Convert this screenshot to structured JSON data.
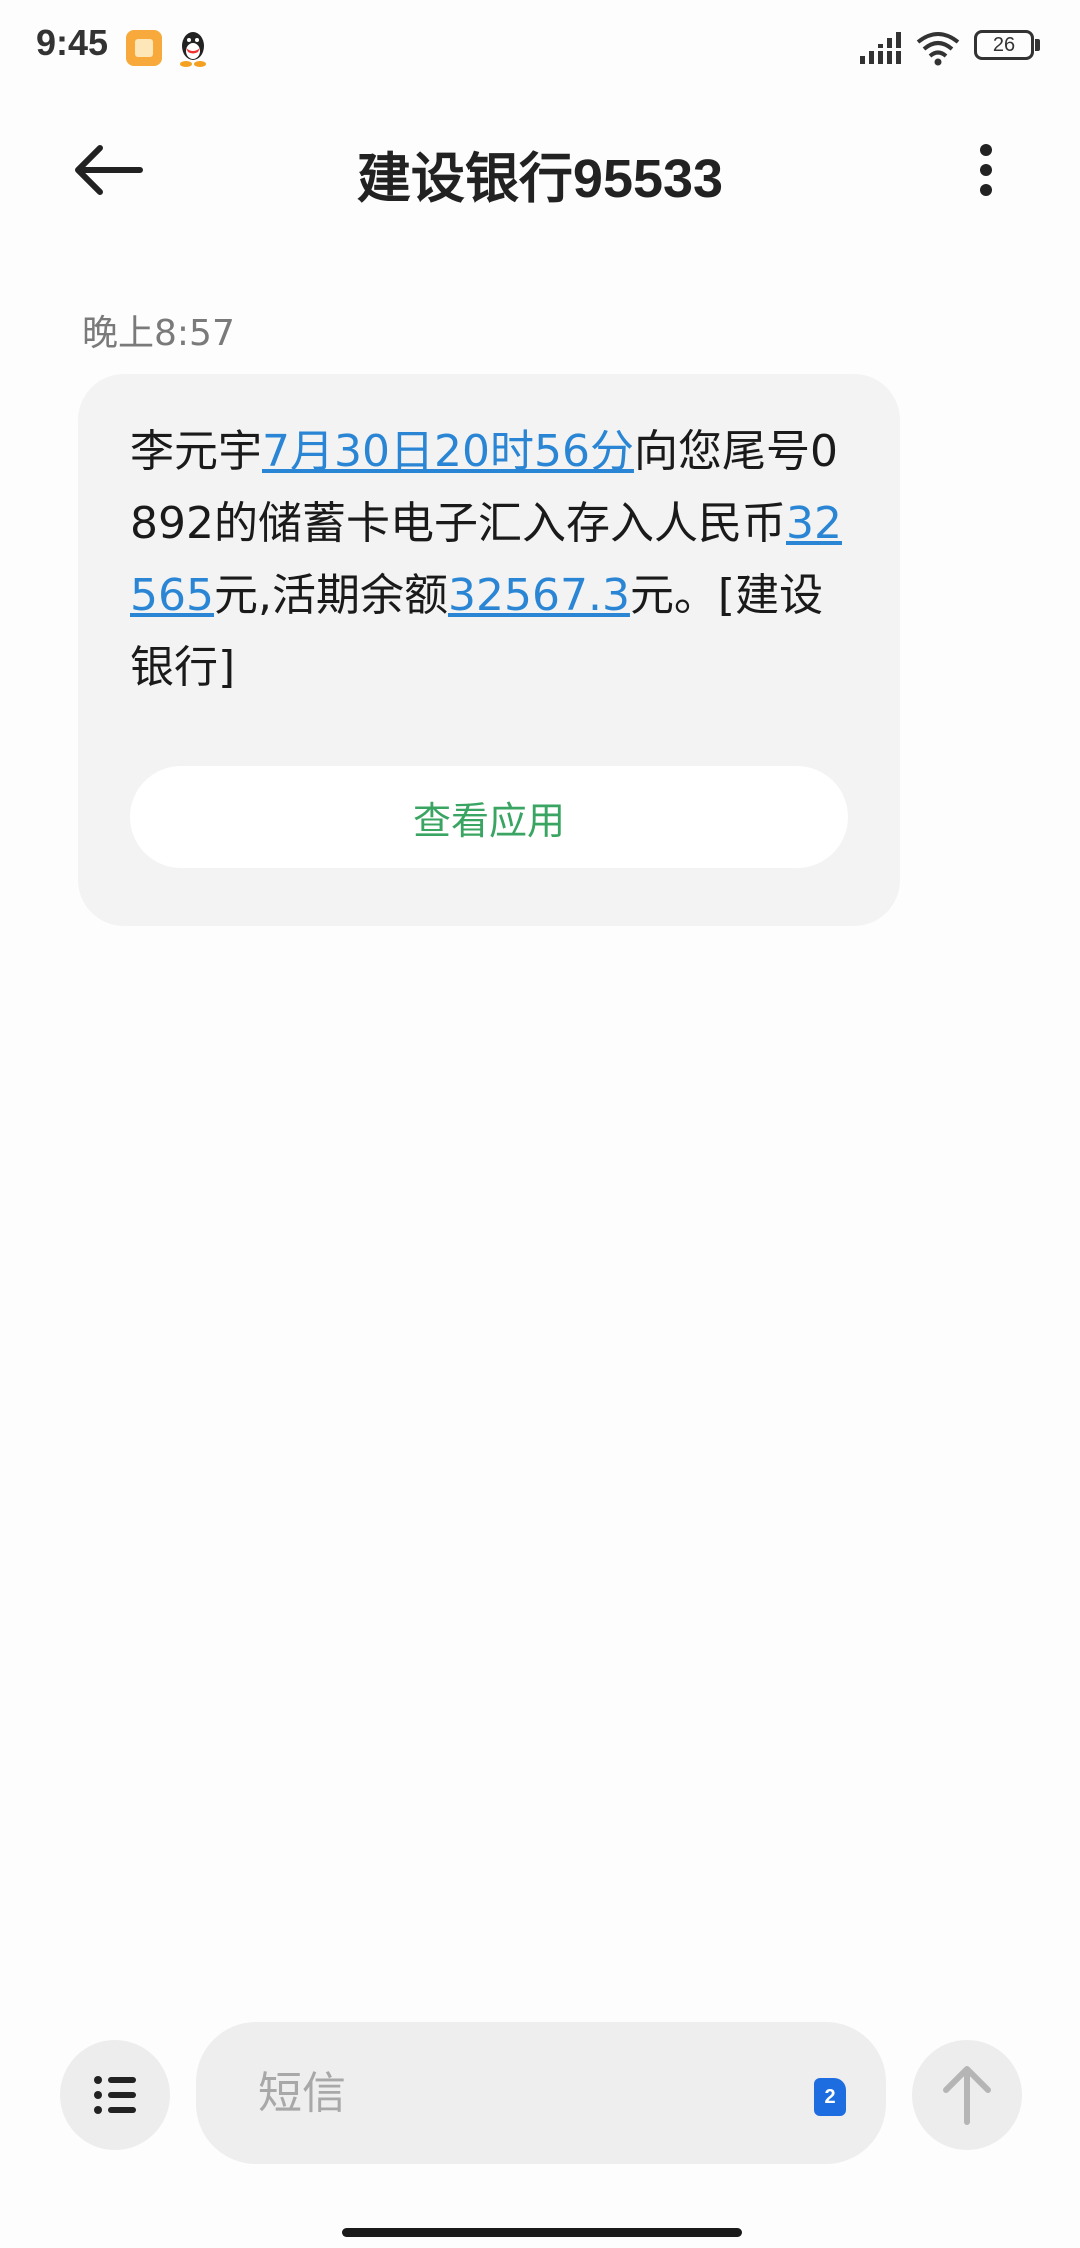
{
  "status_bar": {
    "time": "9:45",
    "icons": [
      "gallery-notification-icon",
      "qq-icon",
      "signal-icon",
      "wifi-icon"
    ],
    "battery_level": "26"
  },
  "header": {
    "title": "建设银行95533",
    "back_icon": "arrow-left-icon",
    "more_icon": "more-vertical-icon"
  },
  "message": {
    "time": "晚上8:57",
    "segments": {
      "s1": "李元宇",
      "date_link": "7月30日20时56分",
      "s2": "向您尾号0892的储蓄卡电子汇入存入人民币",
      "amount_link": "32565",
      "s3": "元,活期余额",
      "balance_link": "32567.3",
      "s4": "元。[建设银行]"
    },
    "action_button": "查看应用"
  },
  "compose": {
    "placeholder": "短信",
    "sim_slot": "2",
    "menu_icon": "list-icon",
    "send_icon": "arrow-up-icon"
  },
  "colors": {
    "link": "#2a86d4",
    "action_green": "#3aa562",
    "sim_blue": "#1e6de0",
    "bubble_bg": "#f3f3f3"
  }
}
